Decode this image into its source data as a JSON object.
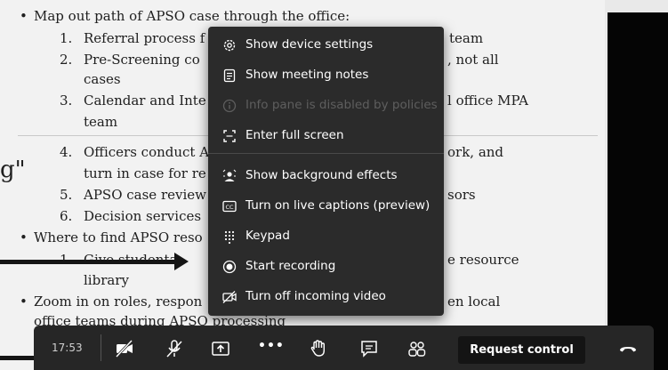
{
  "document": {
    "lines": [
      {
        "bullet": "•",
        "text": "Map out path of APSO case through the office:"
      },
      {
        "num": "1.",
        "text": "Referral process f",
        "tail": "team"
      },
      {
        "num": "2.",
        "text": "Pre-Screening co",
        "tail": ", not all"
      },
      {
        "text": "cases"
      },
      {
        "num": "3.",
        "text": "Calendar and Inte",
        "tail": "l office MPA"
      },
      {
        "text": "team"
      },
      {
        "num": "4.",
        "text": "Officers conduct A",
        "tail": "ork, and"
      },
      {
        "text": "turn in case for re"
      },
      {
        "num": "5.",
        "text": "APSO case review",
        "tail": "sors"
      },
      {
        "num": "6.",
        "text": "Decision services"
      },
      {
        "bullet": "•",
        "text": "Where to find APSO reso"
      },
      {
        "num": "1.",
        "text": "Give studenta",
        "tail": "e resource"
      },
      {
        "text": "library"
      },
      {
        "bullet": "•",
        "text": "Zoom in on roles, respon",
        "tail": "en local"
      },
      {
        "text": "office teams during APSO processing"
      }
    ],
    "quote_fragment": "g\""
  },
  "more_menu": {
    "items": [
      {
        "label": "Show device settings",
        "icon": "gear-icon",
        "disabled": false
      },
      {
        "label": "Show meeting notes",
        "icon": "notes-icon",
        "disabled": false
      },
      {
        "label": "Info pane is disabled by policies",
        "icon": "info-icon",
        "disabled": true
      },
      {
        "label": "Enter full screen",
        "icon": "fullscreen-icon",
        "disabled": false
      },
      {
        "label": "Show background effects",
        "icon": "background-effects-icon",
        "disabled": false
      },
      {
        "label": "Turn on live captions (preview)",
        "icon": "captions-icon",
        "disabled": false
      },
      {
        "label": "Keypad",
        "icon": "keypad-icon",
        "disabled": false
      },
      {
        "label": "Start recording",
        "icon": "record-icon",
        "disabled": false
      },
      {
        "label": "Turn off incoming video",
        "icon": "video-off-icon",
        "disabled": false
      }
    ]
  },
  "toolbar": {
    "timer": "17:53",
    "more_label": "•••",
    "request_control_label": "Request control",
    "icons": [
      "camera-off-icon",
      "mic-off-icon",
      "share-screen-icon",
      "more-options-icon",
      "raise-hand-icon",
      "chat-icon",
      "participants-icon",
      "hang-up-icon"
    ]
  },
  "colors": {
    "menu_background": "#2b2b2b",
    "toolbar_background": "#262626",
    "document_background": "#f2f2f2",
    "disabled_text": "#5e5e5e"
  }
}
